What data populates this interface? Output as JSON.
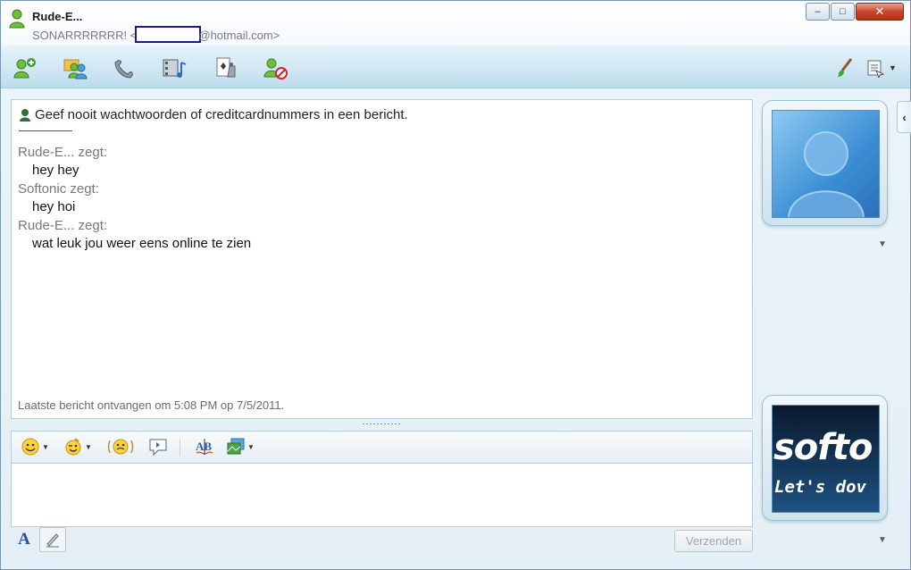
{
  "window": {
    "contact_name": "Rude-E...",
    "contact_status_line_prefix": "SONARRRRRRR! <",
    "contact_email_suffix": "@hotmail.com>",
    "controls": {
      "minimize": "–",
      "maximize": "□",
      "close": "✕"
    }
  },
  "toolbar": {
    "icons": [
      "invite-contact-icon",
      "share-files-icon",
      "call-icon",
      "video-icon",
      "games-icon",
      "block-contact-icon"
    ],
    "right_icons": [
      "paintbrush-icon",
      "menu-icon"
    ]
  },
  "conversation": {
    "warning": "Geef nooit wachtwoorden of creditcardnummers in een bericht.",
    "messages": [
      {
        "sender": "Rude-E... zegt:",
        "text": "hey hey"
      },
      {
        "sender": "Softonic zegt:",
        "text": "hey hoi"
      },
      {
        "sender": "Rude-E... zegt:",
        "text": "wat leuk jou weer eens online te zien"
      }
    ],
    "last_message_info": "Laatste bericht ontvangen om 5:08 PM op 7/5/2011."
  },
  "input_toolbar": {
    "icons": [
      "emoticon-icon",
      "wink-icon",
      "nudge-icon",
      "voice-clip-icon",
      "spellcheck-icon",
      "background-icon"
    ]
  },
  "bottom_bar": {
    "font_label": "A",
    "send_label": "Verzenden"
  },
  "display_pictures": {
    "contact_picture": "default-user-avatar",
    "own_picture_text_line1": "softo",
    "own_picture_text_line2": "Let's dov"
  },
  "colors": {
    "send_disabled": "#9aa6ad",
    "close_button": "#c9452b",
    "sender_text": "#777777"
  }
}
